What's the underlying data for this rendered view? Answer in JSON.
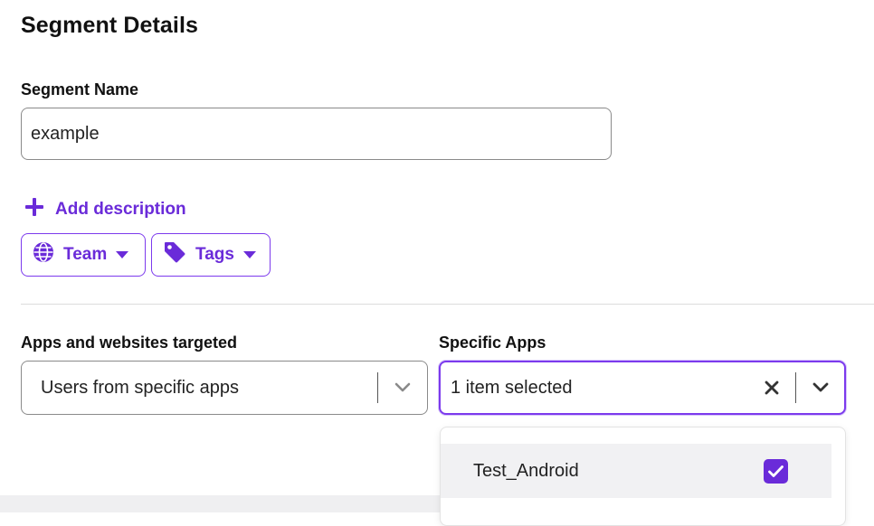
{
  "section": {
    "title": "Segment Details"
  },
  "segment_name": {
    "label": "Segment Name",
    "value": "example"
  },
  "add_description": {
    "label": "Add description"
  },
  "chips": {
    "team": "Team",
    "tags": "Tags"
  },
  "apps_targeted": {
    "label": "Apps and websites targeted",
    "value": "Users from specific apps"
  },
  "specific_apps": {
    "label": "Specific Apps",
    "value": "1 item selected",
    "options": [
      {
        "label": "Test_Android",
        "checked": true
      }
    ]
  },
  "colors": {
    "accent": "#6a2bd9",
    "focus_border": "#7c3aed",
    "option_bg": "#f1f1f3"
  },
  "icons": [
    "plus-icon",
    "globe-icon",
    "caret-down-icon",
    "tag-icon",
    "chevron-down-icon",
    "clear-icon",
    "checkmark-icon"
  ]
}
